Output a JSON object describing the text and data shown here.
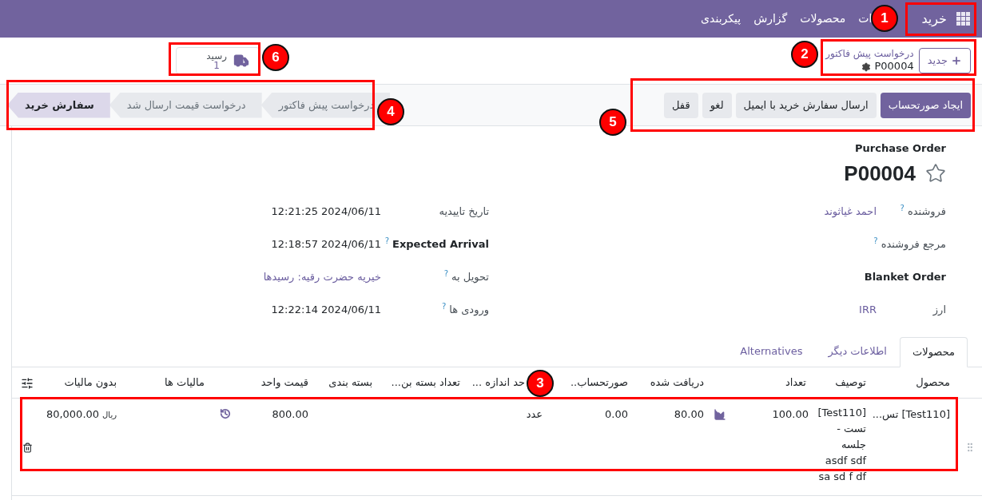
{
  "navbar": {
    "app": "خرید",
    "menu": [
      "ات",
      "محصولات",
      "گزارش",
      "پیکربندی"
    ]
  },
  "control_panel": {
    "new_button": "جدید",
    "breadcrumb": "درخواست پیش فاکتور",
    "record": "P00004",
    "smart_button": {
      "label": "رسید",
      "count": "1"
    }
  },
  "actions": [
    {
      "label": "ایجاد صورتحساب",
      "primary": true
    },
    {
      "label": "ارسال سفارش خرید با ایمیل",
      "primary": false
    },
    {
      "label": "لغو",
      "primary": false
    },
    {
      "label": "قفل",
      "primary": false
    }
  ],
  "statusbar": [
    {
      "label": "درخواست پیش فاکتور",
      "selected": false
    },
    {
      "label": "درخواست قیمت ارسال شد",
      "selected": false
    },
    {
      "label": "سفارش خرید",
      "selected": true
    }
  ],
  "sheet": {
    "subtitle": "Purchase Order",
    "title": "P00004",
    "starred": false,
    "fields_right": [
      {
        "label": "فروشنده",
        "help": "?",
        "value": "احمد غیاثوند",
        "bold": false
      },
      {
        "label": "مرجع فروشنده",
        "help": "?",
        "bold": false
      },
      {
        "label": "Blanket Order",
        "bold": true
      },
      {
        "label": "ارز",
        "value": "IRR",
        "bold": false
      }
    ],
    "fields_left": [
      {
        "label": "تاریخ تاییدیه",
        "value": "12:21:25 2024/06/11",
        "bold": false,
        "link": false
      },
      {
        "label": "Expected Arrival",
        "help": "?",
        "value": "12:18:57 2024/06/11",
        "bold": true,
        "link": false
      },
      {
        "label": "تحویل به",
        "help": "?",
        "value": "خیریه حضرت رقیه: رسیدها",
        "bold": false,
        "link": true
      },
      {
        "label": "ورودی ها",
        "help": "?",
        "value": "12:22:14 2024/06/11",
        "bold": false,
        "link": false
      }
    ]
  },
  "tabs": [
    {
      "label": "محصولات",
      "selected": true
    },
    {
      "label": "اطلاعات دیگر",
      "selected": false
    },
    {
      "label": "Alternatives",
      "selected": false
    }
  ],
  "table": {
    "columns": [
      "محصول",
      "توصیف",
      "تعداد",
      "دریافت شده",
      "صورتحساب..",
      "حد اندازه ...",
      "تعداد بسته بن...",
      "بسته بندی",
      "قیمت واحد",
      "مالیات ها",
      "بدون مالیات"
    ],
    "rows": [
      {
        "product": "[Test110] تس...",
        "description_lines": [
          "[Test110]",
          "تست -",
          "جلسه",
          "asdf sdf",
          "sa sd f df"
        ],
        "quantity": "100.00",
        "received": "80.00",
        "invoiced": "0.00",
        "uom": "عدد",
        "unit_price": "800.00",
        "subtotal": "80,000.00",
        "currency": "ریال"
      }
    ]
  },
  "annotations": [
    {
      "number": "1"
    },
    {
      "number": "2"
    },
    {
      "number": "3"
    },
    {
      "number": "4"
    },
    {
      "number": "5"
    },
    {
      "number": "6"
    }
  ]
}
